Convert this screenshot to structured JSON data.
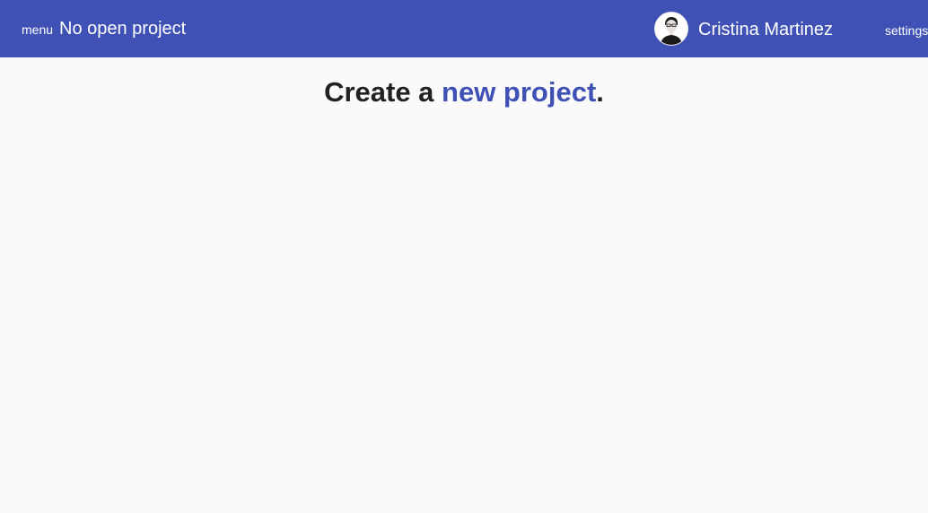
{
  "header": {
    "menu_label": "menu",
    "project_title": "No open project",
    "user_name": "Cristina Martinez",
    "settings_label": "settings",
    "avatar_icon": "user-avatar-icon"
  },
  "main": {
    "headline_prefix": "Create a ",
    "headline_link": "new project",
    "headline_suffix": "."
  },
  "colors": {
    "primary": "#3f51b5",
    "background": "#fafafa",
    "text": "#212121",
    "header_text": "#ffffff"
  }
}
